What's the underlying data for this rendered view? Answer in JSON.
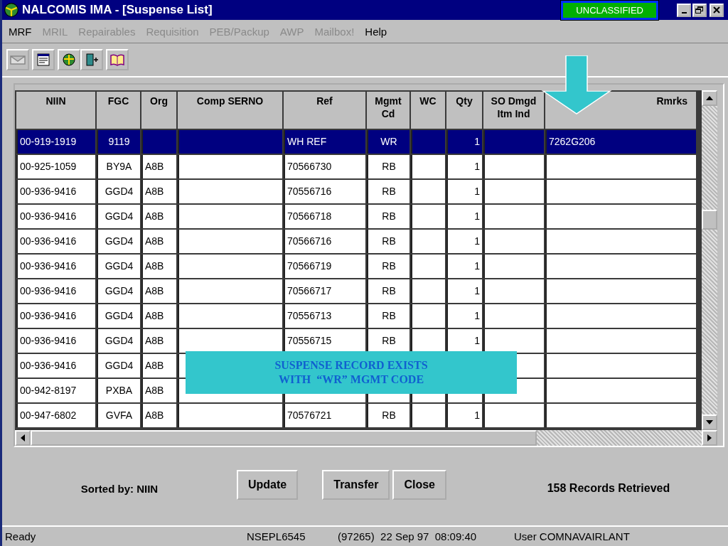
{
  "window": {
    "title": "NALCOMIS IMA - [Suspense List]",
    "classification": "UNCLASSIFIED"
  },
  "menu": [
    {
      "label": "MRF",
      "disabled": false
    },
    {
      "label": "MRIL",
      "disabled": true
    },
    {
      "label": "Repairables",
      "disabled": true
    },
    {
      "label": "Requisition",
      "disabled": true
    },
    {
      "label": "PEB/Packup",
      "disabled": true
    },
    {
      "label": "AWP",
      "disabled": true
    },
    {
      "label": "Mailbox!",
      "disabled": true
    },
    {
      "label": "Help",
      "disabled": false
    }
  ],
  "table": {
    "columns": [
      "NIIN",
      "FGC",
      "Org",
      "Comp SERNO",
      "Ref",
      "Mgmt Cd",
      "WC",
      "Qty",
      "SO Dmgd Itm Ind",
      "Rmrks"
    ],
    "rows": [
      {
        "selected": true,
        "niin": "00-919-1919",
        "fgc": "9119",
        "ref": "WH REF",
        "mgmt_cd": "WR",
        "qty": "1",
        "rmrks": "7262G206"
      },
      {
        "selected": false,
        "niin": "00-925-1059",
        "fgc": "BY9A",
        "org": "A8B",
        "ref": "70566730",
        "mgmt_cd": "RB",
        "qty": "1"
      },
      {
        "selected": false,
        "niin": "00-936-9416",
        "fgc": "GGD4",
        "org": "A8B",
        "ref": "70556716",
        "mgmt_cd": "RB",
        "qty": "1"
      },
      {
        "selected": false,
        "niin": "00-936-9416",
        "fgc": "GGD4",
        "org": "A8B",
        "ref": "70566718",
        "mgmt_cd": "RB",
        "qty": "1"
      },
      {
        "selected": false,
        "niin": "00-936-9416",
        "fgc": "GGD4",
        "org": "A8B",
        "ref": "70566716",
        "mgmt_cd": "RB",
        "qty": "1"
      },
      {
        "selected": false,
        "niin": "00-936-9416",
        "fgc": "GGD4",
        "org": "A8B",
        "ref": "70566719",
        "mgmt_cd": "RB",
        "qty": "1"
      },
      {
        "selected": false,
        "niin": "00-936-9416",
        "fgc": "GGD4",
        "org": "A8B",
        "ref": "70566717",
        "mgmt_cd": "RB",
        "qty": "1"
      },
      {
        "selected": false,
        "niin": "00-936-9416",
        "fgc": "GGD4",
        "org": "A8B",
        "ref": "70556713",
        "mgmt_cd": "RB",
        "qty": "1"
      },
      {
        "selected": false,
        "niin": "00-936-9416",
        "fgc": "GGD4",
        "org": "A8B",
        "ref": "70556715",
        "mgmt_cd": "RB",
        "qty": "1"
      },
      {
        "selected": false,
        "niin": "00-936-9416",
        "fgc": "GGD4",
        "org": "A8B"
      },
      {
        "selected": false,
        "niin": "00-942-8197",
        "fgc": "PXBA",
        "org": "A8B"
      },
      {
        "selected": false,
        "niin": "00-947-6802",
        "fgc": "GVFA",
        "org": "A8B",
        "ref": "70576721",
        "mgmt_cd": "RB",
        "qty": "1"
      }
    ]
  },
  "callout": {
    "lines": [
      "SUSPENSE RECORD EXISTS",
      "WITH  “WR” MGMT CODE"
    ]
  },
  "footer": {
    "sorted_by": "Sorted by: NIIN",
    "buttons": [
      "Update",
      "Transfer",
      "Close"
    ],
    "records": "158 Records Retrieved"
  },
  "status_bar": {
    "state": "Ready",
    "terminal": "NSEPL6545",
    "timestamp": "(97265)  22 Sep 97  08:09:40",
    "user": "User COMNAVAIRLANT"
  }
}
